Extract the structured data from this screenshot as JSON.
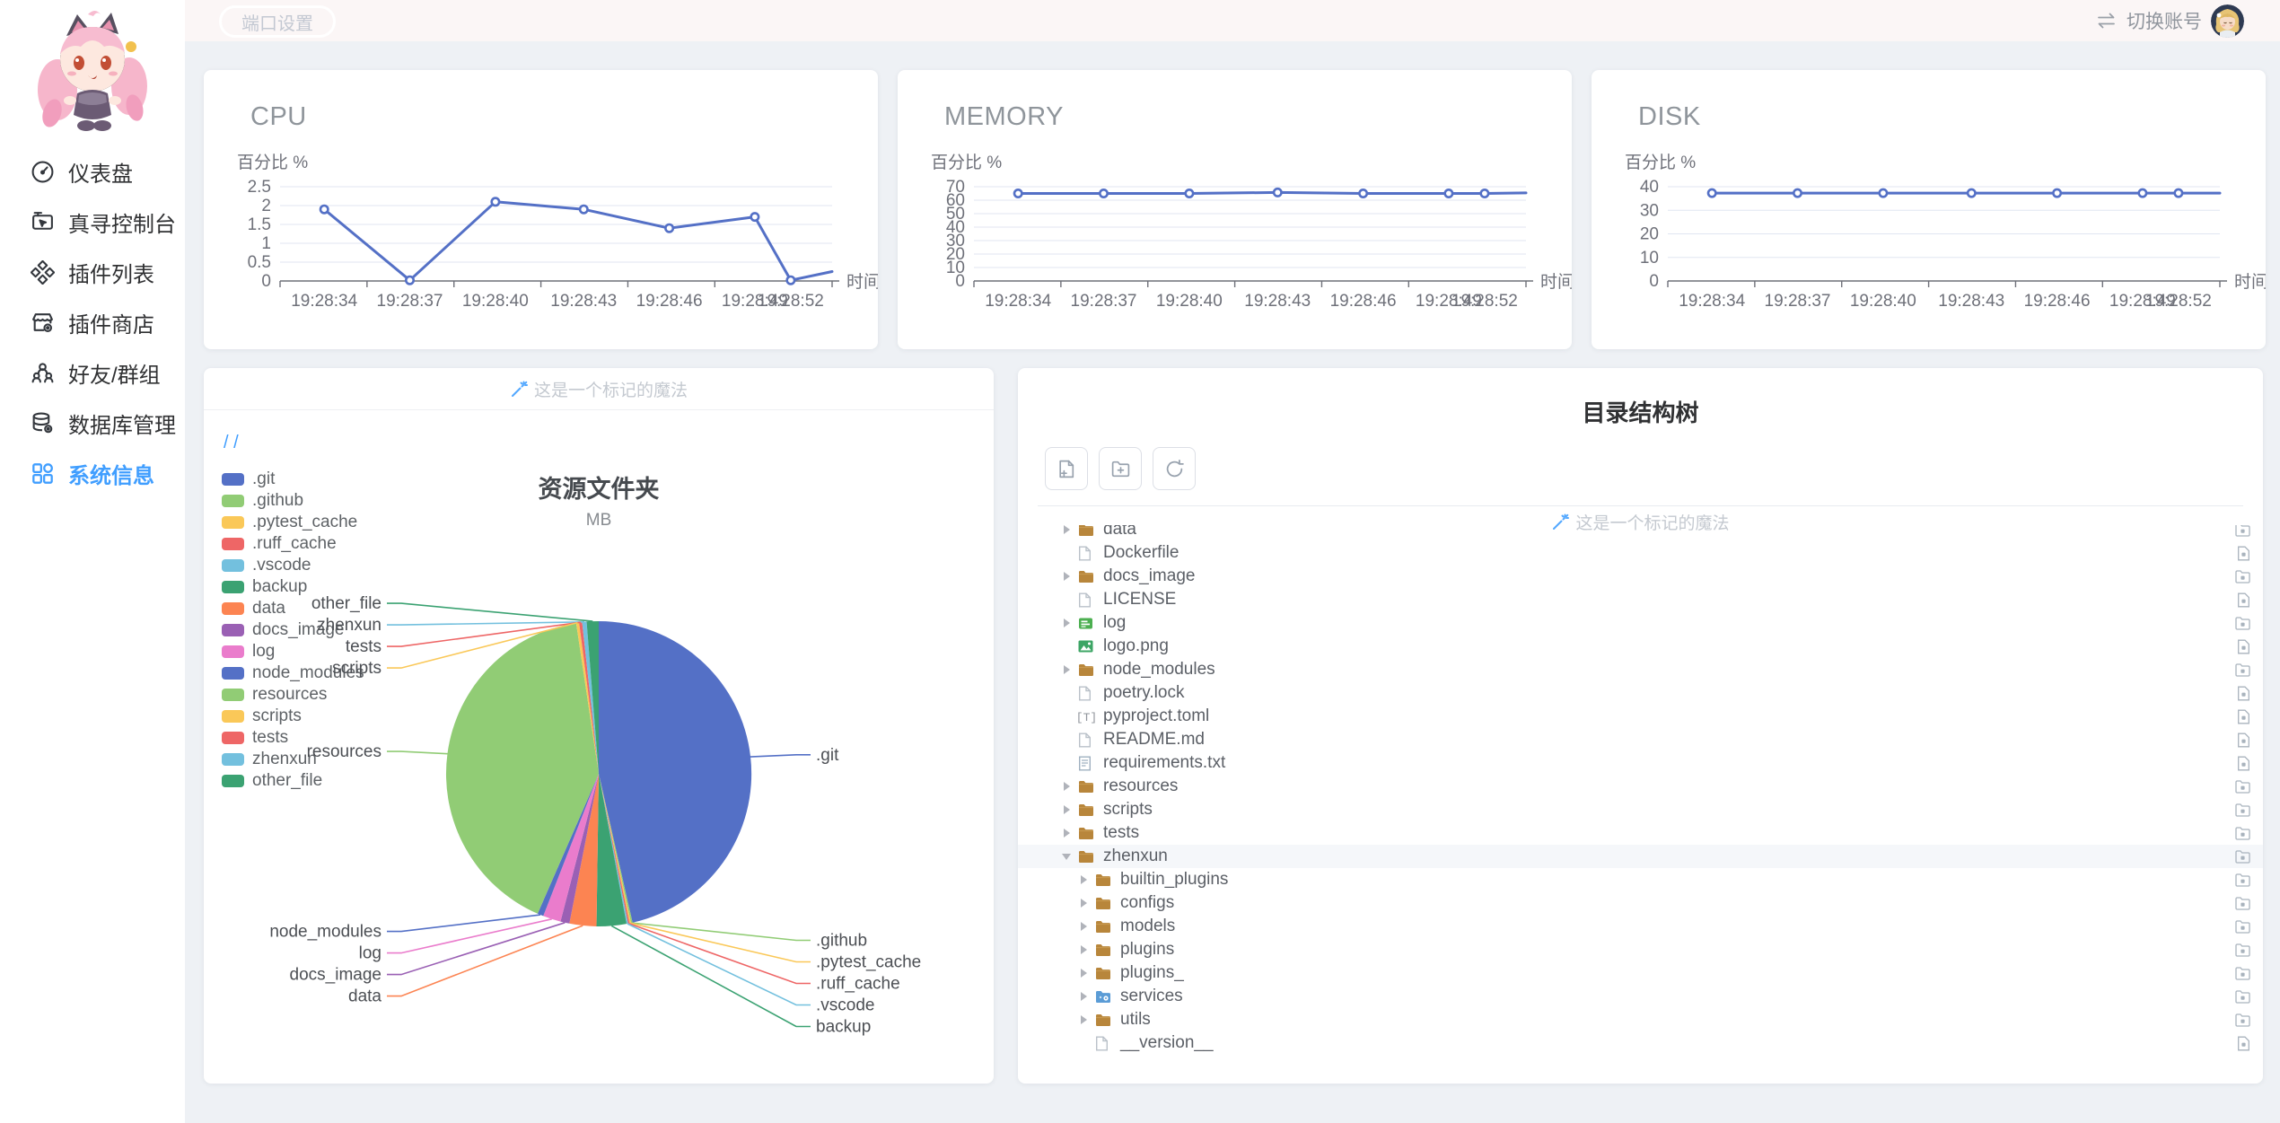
{
  "topbar": {
    "port_button": "端口设置",
    "switch_account": "切换账号"
  },
  "watermark": {
    "text": "这是一个标记的魔法"
  },
  "sidebar": {
    "items": [
      {
        "label": "仪表盘",
        "icon": "gauge-icon",
        "active": false
      },
      {
        "label": "真寻控制台",
        "icon": "console-icon",
        "active": false
      },
      {
        "label": "插件列表",
        "icon": "plugins-icon",
        "active": false
      },
      {
        "label": "插件商店",
        "icon": "store-icon",
        "active": false
      },
      {
        "label": "好友/群组",
        "icon": "friends-icon",
        "active": false
      },
      {
        "label": "数据库管理",
        "icon": "database-icon",
        "active": false
      },
      {
        "label": "系统信息",
        "icon": "grid-icon",
        "active": true
      }
    ]
  },
  "pie_card": {
    "breadcrumb": "/ /"
  },
  "tree_card": {
    "title": "目录结构树",
    "toolbar": [
      "new-file-icon",
      "new-folder-icon",
      "refresh-icon"
    ],
    "rows": [
      {
        "label": "data",
        "icon": "folder",
        "arrow": "right",
        "depth": 0,
        "dl": "folder",
        "selected": false
      },
      {
        "label": "Dockerfile",
        "icon": "file",
        "arrow": "none",
        "depth": 0,
        "dl": "file",
        "selected": false
      },
      {
        "label": "docs_image",
        "icon": "folder",
        "arrow": "right",
        "depth": 0,
        "dl": "folder",
        "selected": false
      },
      {
        "label": "LICENSE",
        "icon": "file",
        "arrow": "none",
        "depth": 0,
        "dl": "file",
        "selected": false
      },
      {
        "label": "log",
        "icon": "log",
        "arrow": "right",
        "depth": 0,
        "dl": "folder",
        "selected": false
      },
      {
        "label": "logo.png",
        "icon": "image",
        "arrow": "none",
        "depth": 0,
        "dl": "file",
        "selected": false
      },
      {
        "label": "node_modules",
        "icon": "folder",
        "arrow": "right",
        "depth": 0,
        "dl": "folder",
        "selected": false
      },
      {
        "label": "poetry.lock",
        "icon": "file",
        "arrow": "none",
        "depth": 0,
        "dl": "file",
        "selected": false
      },
      {
        "label": "pyproject.toml",
        "icon": "toml",
        "arrow": "none",
        "depth": 0,
        "dl": "file",
        "selected": false
      },
      {
        "label": "README.md",
        "icon": "file",
        "arrow": "none",
        "depth": 0,
        "dl": "file",
        "selected": false
      },
      {
        "label": "requirements.txt",
        "icon": "txt",
        "arrow": "none",
        "depth": 0,
        "dl": "file",
        "selected": false
      },
      {
        "label": "resources",
        "icon": "folder",
        "arrow": "right",
        "depth": 0,
        "dl": "folder",
        "selected": false
      },
      {
        "label": "scripts",
        "icon": "folder",
        "arrow": "right",
        "depth": 0,
        "dl": "folder",
        "selected": false
      },
      {
        "label": "tests",
        "icon": "folder",
        "arrow": "right",
        "depth": 0,
        "dl": "folder",
        "selected": false
      },
      {
        "label": "zhenxun",
        "icon": "folder",
        "arrow": "down",
        "depth": 0,
        "dl": "folder",
        "selected": true
      },
      {
        "label": "builtin_plugins",
        "icon": "folder",
        "arrow": "right",
        "depth": 1,
        "dl": "folder",
        "selected": false
      },
      {
        "label": "configs",
        "icon": "folder",
        "arrow": "right",
        "depth": 1,
        "dl": "folder",
        "selected": false
      },
      {
        "label": "models",
        "icon": "folder",
        "arrow": "right",
        "depth": 1,
        "dl": "folder",
        "selected": false
      },
      {
        "label": "plugins",
        "icon": "folder",
        "arrow": "right",
        "depth": 1,
        "dl": "folder",
        "selected": false
      },
      {
        "label": "plugins_",
        "icon": "folder",
        "arrow": "right",
        "depth": 1,
        "dl": "folder",
        "selected": false
      },
      {
        "label": "services",
        "icon": "services",
        "arrow": "right",
        "depth": 1,
        "dl": "folder",
        "selected": false
      },
      {
        "label": "utils",
        "icon": "folder",
        "arrow": "right",
        "depth": 1,
        "dl": "folder",
        "selected": false
      },
      {
        "label": "__version__",
        "icon": "file",
        "arrow": "none",
        "depth": 1,
        "dl": "file",
        "selected": false
      }
    ]
  },
  "chart_data": [
    {
      "type": "line",
      "title": "CPU",
      "ylabel": "百分比 %",
      "xlabel": "时间",
      "x": [
        "19:28:34",
        "19:28:37",
        "19:28:40",
        "19:28:43",
        "19:28:46",
        "19:28:49",
        "19:28:52"
      ],
      "x_fractions": [
        0.08,
        0.235,
        0.39,
        0.55,
        0.705,
        0.86,
        0.925
      ],
      "axis_tick_fractions": [
        0,
        0.1575,
        0.315,
        0.4725,
        0.63,
        0.7875,
        1
      ],
      "values": [
        1.9,
        0.02,
        2.1,
        1.9,
        1.4,
        1.7,
        0.02
      ],
      "line_end": 0.25,
      "ylim": [
        0,
        2.5
      ],
      "yticks": [
        0,
        0.5,
        1,
        1.5,
        2,
        2.5
      ],
      "line_color": "#5470c6",
      "grid": true,
      "legend_position": "none"
    },
    {
      "type": "line",
      "title": "MEMORY",
      "ylabel": "百分比 %",
      "xlabel": "时间",
      "x": [
        "19:28:34",
        "19:28:37",
        "19:28:40",
        "19:28:43",
        "19:28:46",
        "19:28:49",
        "19:28:52"
      ],
      "x_fractions": [
        0.08,
        0.235,
        0.39,
        0.55,
        0.705,
        0.86,
        0.925
      ],
      "axis_tick_fractions": [
        0,
        0.1575,
        0.315,
        0.4725,
        0.63,
        0.7875,
        1
      ],
      "values": [
        65,
        65,
        65,
        65.7,
        65,
        65,
        65
      ],
      "line_end": 65.4,
      "ylim": [
        0,
        70
      ],
      "yticks": [
        0,
        10,
        20,
        30,
        40,
        50,
        60,
        70
      ],
      "line_color": "#5470c6",
      "grid": true,
      "legend_position": "none"
    },
    {
      "type": "line",
      "title": "DISK",
      "ylabel": "百分比 %",
      "xlabel": "时间",
      "x": [
        "19:28:34",
        "19:28:37",
        "19:28:40",
        "19:28:43",
        "19:28:46",
        "19:28:49",
        "19:28:52"
      ],
      "x_fractions": [
        0.08,
        0.235,
        0.39,
        0.55,
        0.705,
        0.86,
        0.925
      ],
      "axis_tick_fractions": [
        0,
        0.1575,
        0.315,
        0.4725,
        0.63,
        0.7875,
        1
      ],
      "values": [
        37.3,
        37.3,
        37.3,
        37.3,
        37.3,
        37.3,
        37.3
      ],
      "line_end": 37.3,
      "ylim": [
        0,
        40
      ],
      "yticks": [
        0,
        10,
        20,
        30,
        40
      ],
      "line_color": "#5470c6",
      "grid": true,
      "legend_position": "none"
    },
    {
      "type": "pie",
      "title": "资源文件夹",
      "subtitle": "MB",
      "unit": "MB",
      "labels": [
        ".git",
        ".github",
        ".pytest_cache",
        ".ruff_cache",
        ".vscode",
        "backup",
        "data",
        "docs_image",
        "log",
        "node_modules",
        "resources",
        "scripts",
        "tests",
        "zhenxun",
        "other_file"
      ],
      "values": [
        294,
        1,
        1,
        1,
        1,
        20,
        18,
        6,
        12,
        4,
        260,
        2,
        2,
        3,
        8
      ],
      "values_note": "estimated from slice angles, no numbers shown on screen",
      "colors": [
        "#5470c6",
        "#91cc75",
        "#fac858",
        "#ee6666",
        "#73c0de",
        "#3ba272",
        "#fc8452",
        "#9a60b4",
        "#ea7ccc",
        "#5470c6",
        "#91cc75",
        "#fac858",
        "#ee6666",
        "#73c0de",
        "#3ba272"
      ],
      "legend_position": "left"
    }
  ]
}
